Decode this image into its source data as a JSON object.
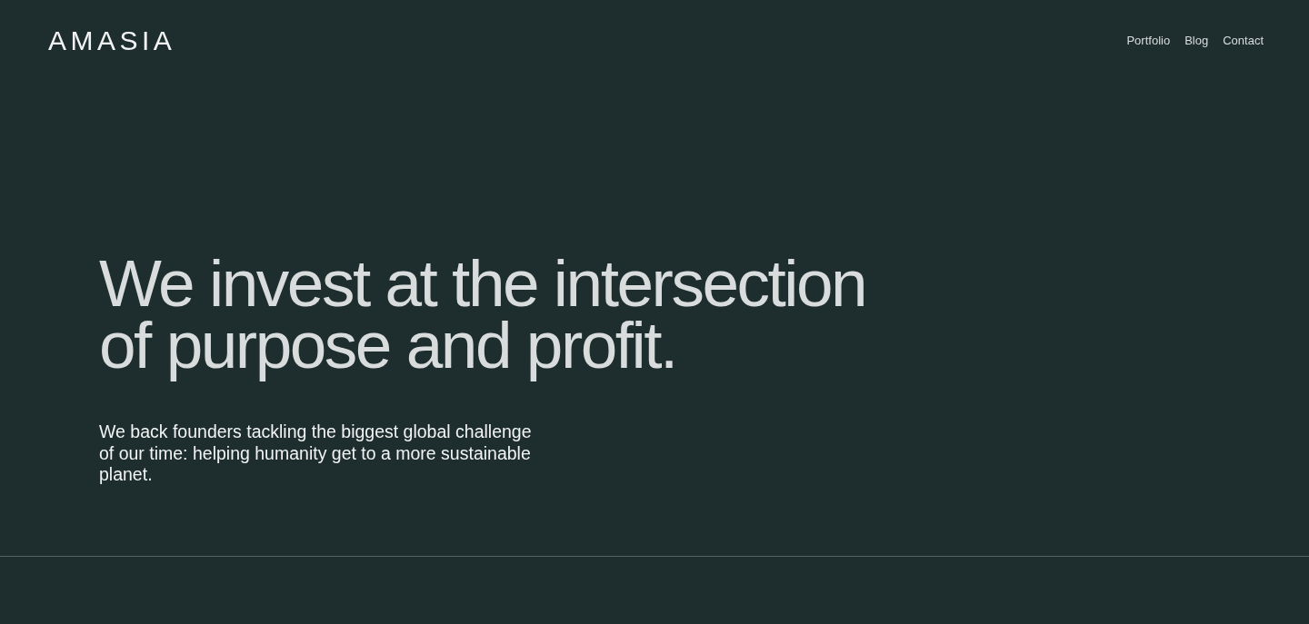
{
  "header": {
    "logo": "AMASIA",
    "nav_links": [
      "Portfolio",
      "Blog",
      "Contact"
    ]
  },
  "hero": {
    "heading": "We invest at the intersection of purpose and profit.",
    "subheading": "We back founders tackling the biggest global challenge of our time: helping humanity get to a more sustainable planet."
  }
}
